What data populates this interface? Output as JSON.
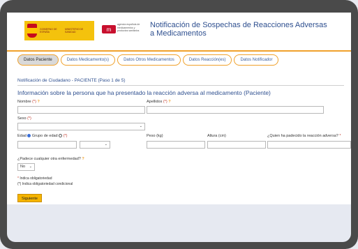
{
  "header": {
    "gov_line": "GOBIERNO DE ESPAÑA",
    "ministry_line": "MINISTERIO DE SANIDAD",
    "agency_line": "agencia española de medicamentos y productos sanitarios",
    "title": "Notificación de Sospechas de Reacciones Adversas a Medicamentos"
  },
  "tabs": [
    {
      "label": "Datos Paciente"
    },
    {
      "label": "Datos Medicamento(s)"
    },
    {
      "label": "Datos Otros Medicamentos"
    },
    {
      "label": "Datos Reacción(es)"
    },
    {
      "label": "Datos Notificador"
    }
  ],
  "step_title": "Notificación de Ciudadano - PACIENTE (Paso 1 de 5)",
  "section_title": "Información sobre la persona que ha presentado la reacción adversa al medicamento (Paciente)",
  "fields": {
    "nombre": {
      "label": "Nombre",
      "req": "(*)",
      "help": "?"
    },
    "apellidos": {
      "label": "Apellidos",
      "req": "(*)",
      "help": "?"
    },
    "sexo": {
      "label": "Sexo",
      "req": "(*)"
    },
    "edad": {
      "label": "Edad",
      "grupo": "Grupo de edad",
      "req": "(*)"
    },
    "peso": {
      "label": "Peso (kg)"
    },
    "altura": {
      "label": "Altura (cm)"
    },
    "quien": {
      "label": "¿Quien ha padecido la reacción adversa?",
      "req": "*"
    },
    "otra": {
      "label": "¿Padece cualquier otra enfermedad?",
      "help": "?",
      "value": "No"
    }
  },
  "notes": {
    "obligatorio": "Indica obligatoriedad",
    "condicional": "(*) Indica obligatoriedad condicional",
    "star": "*"
  },
  "next_button": "Siguiente"
}
